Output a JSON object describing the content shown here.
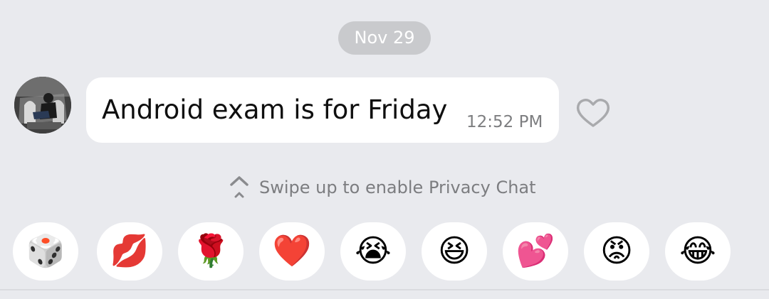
{
  "chat": {
    "date_chip": "Nov 29",
    "message": {
      "text": "Android exam is for Friday",
      "time": "12:52 PM",
      "avatar_icon": "user-avatar",
      "like_icon": "heart-outline-icon"
    },
    "privacy_hint": {
      "icon": "chevron-up-icon",
      "text": "Swipe up to enable Privacy Chat"
    }
  },
  "reactions": [
    {
      "name": "dice-icon",
      "glyph": "🎲"
    },
    {
      "name": "kiss-lips-icon",
      "glyph": "💋"
    },
    {
      "name": "rose-icon",
      "glyph": "🌹"
    },
    {
      "name": "red-heart-icon",
      "glyph": "❤️"
    },
    {
      "name": "crying-face-icon",
      "glyph": "😭"
    },
    {
      "name": "grinning-squint-face-icon",
      "glyph": "😆"
    },
    {
      "name": "two-hearts-icon",
      "glyph": "💕"
    },
    {
      "name": "angry-face-icon",
      "glyph": "😡"
    },
    {
      "name": "tears-of-joy-face-icon",
      "glyph": "😂"
    }
  ],
  "colors": {
    "background": "#e9eaee",
    "bubble": "#ffffff",
    "date_chip": "#c9cacd",
    "muted_text": "#7c7d80"
  }
}
